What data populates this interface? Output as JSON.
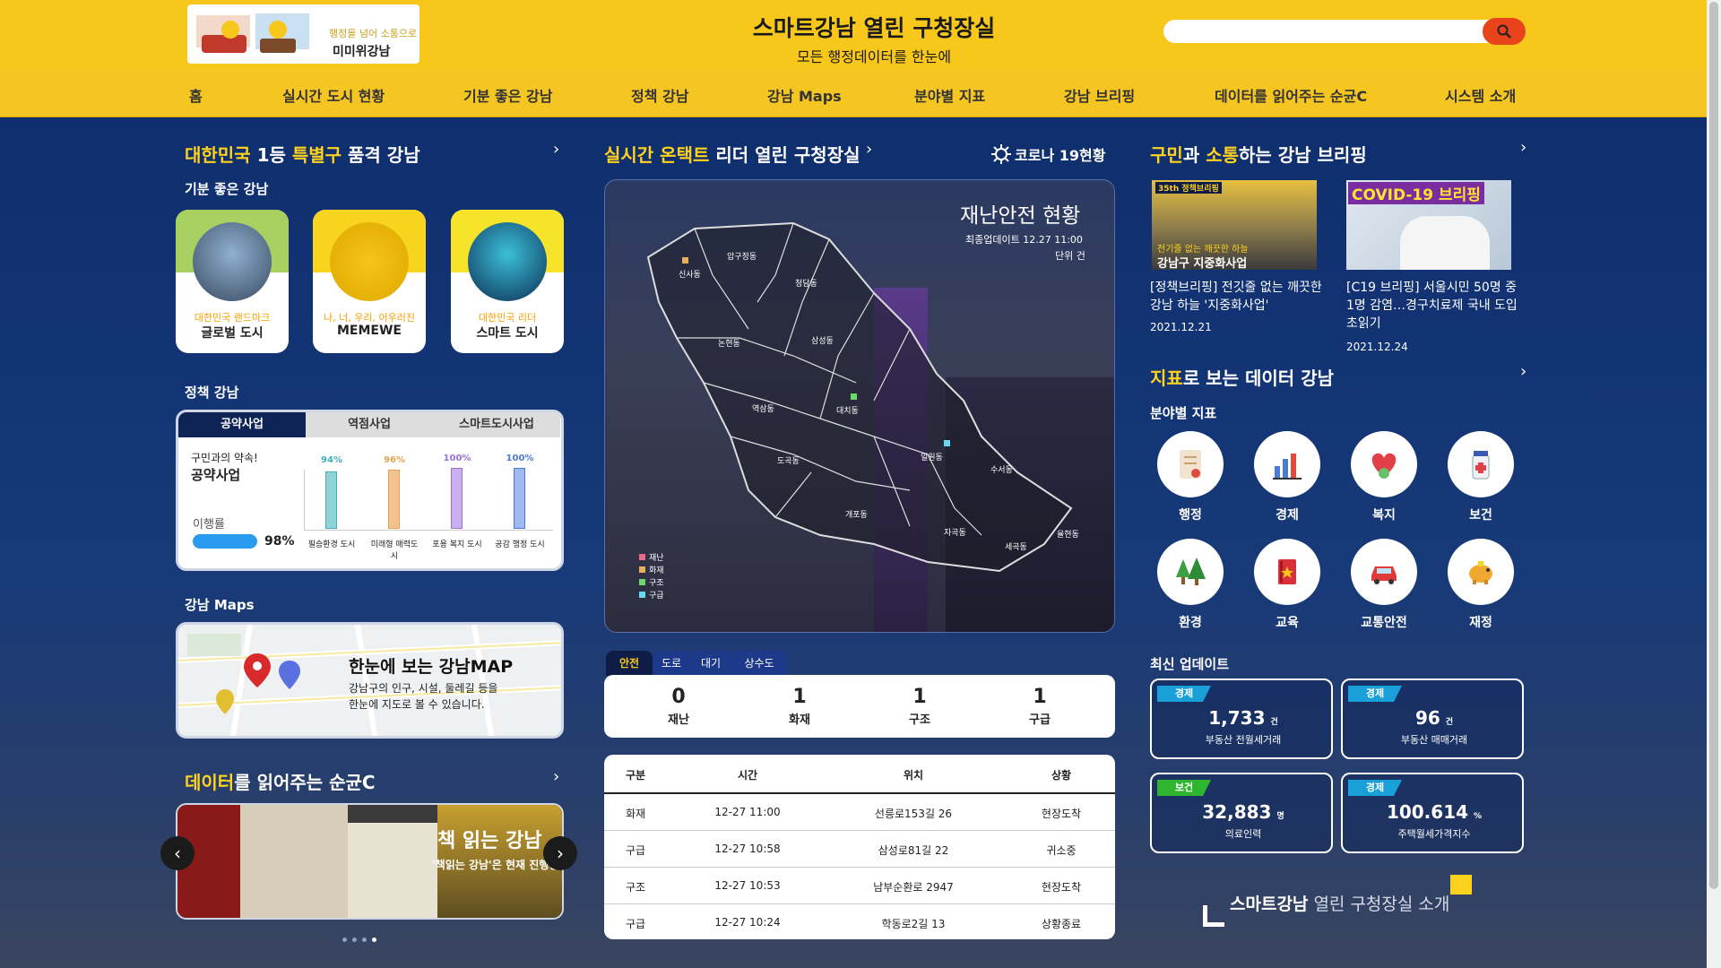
{
  "header": {
    "logo_small": "행정을 넘어 소통으로",
    "logo_text": "미미위강남",
    "title": "스마트강남 열린 구청장실",
    "subtitle": "모든 행정데이터를 한눈에",
    "search_placeholder": ""
  },
  "nav": [
    "홈",
    "실시간 도시 현황",
    "기분 좋은 강남",
    "정책 강남",
    "강남 Maps",
    "분야별 지표",
    "강남 브리핑",
    "데이터를 읽어주는 순균C",
    "시스템 소개"
  ],
  "left": {
    "title_y1": "대한민국",
    "title_w1": " 1등 ",
    "title_y2": "특별구",
    "title_w2": " 품격 강남",
    "mood": "기분 좋은 강남",
    "cards": [
      {
        "sub": "대한민국 랜드마크",
        "main": "글로벌 도시"
      },
      {
        "sub": "나, 너, 우리, 어우러진",
        "main": "MEMEWE"
      },
      {
        "sub": "대한민국 리더",
        "main": "스마트 도시"
      }
    ],
    "policy_title": "정책 강남",
    "policy_tabs": [
      "공약사업",
      "역점사업",
      "스마트도시사업"
    ],
    "policy_promise1": "구민과의 약속!",
    "policy_promise2": "공약사업",
    "policy_rate_label": "이행률",
    "policy_rate": "98%",
    "policy_bars": [
      {
        "pct": "94%",
        "label": "필승환경 도시"
      },
      {
        "pct": "96%",
        "label": "미래형 매력도시"
      },
      {
        "pct": "100%",
        "label": "포용 복지 도시"
      },
      {
        "pct": "100%",
        "label": "공감 행정 도시"
      }
    ],
    "maps_title": "강남 Maps",
    "maps_head": "한눈에 보는 강남MAP",
    "maps_desc1": "강남구의 인구, 시설, 둘레길 등을",
    "maps_desc2": "한눈에 지도로 볼 수 있습니다.",
    "data_title_y": "데이터",
    "data_title_w": "를 읽어주는 순균C",
    "book_head": "책 읽는 강남",
    "book_sub": "'책읽는 강남'은 현재 진행형"
  },
  "center": {
    "title_y": "실시간 온택트",
    "title_w": " 리더 열린 구청장실",
    "covid_btn": "코로나 19현황",
    "safety_title": "재난안전 현황",
    "safety_update": "최종업데이트 12.27 11:00",
    "safety_unit": "단위 건",
    "dongs": [
      "신사동",
      "압구정동",
      "청담동",
      "논현동",
      "삼성동",
      "역삼동",
      "대치동",
      "도곡동",
      "일원동",
      "수서동",
      "개포동",
      "자곡동",
      "세곡동",
      "율현동"
    ],
    "legend": [
      "재난",
      "화재",
      "구조",
      "구급"
    ],
    "tabs": [
      "안전",
      "도로",
      "대기",
      "상수도"
    ],
    "stats": [
      {
        "n": "0",
        "l": "재난"
      },
      {
        "n": "1",
        "l": "화재"
      },
      {
        "n": "1",
        "l": "구조"
      },
      {
        "n": "1",
        "l": "구급"
      }
    ],
    "table_head": [
      "구분",
      "시간",
      "위치",
      "상황"
    ],
    "rows": [
      [
        "화재",
        "12-27 11:00",
        "선릉로153길 26",
        "현장도착"
      ],
      [
        "구급",
        "12-27 10:58",
        "삼성로81길 22",
        "귀소중"
      ],
      [
        "구조",
        "12-27 10:53",
        "남부순환로 2947",
        "현장도착"
      ],
      [
        "구급",
        "12-27 10:24",
        "학동로2길 13",
        "상황종료"
      ]
    ]
  },
  "right": {
    "brief_y1": "구민",
    "brief_w1": "과 ",
    "brief_y2": "소통",
    "brief_w2": "하는 강남 브리핑",
    "briefs": [
      {
        "tag": "35th 정책브리핑",
        "img_text1": "전기줄 없는 깨끗한 하늘",
        "img_text2": "강남구 지중화사업",
        "title": "[정책브리핑] 전깃줄 없는 깨끗한 강남 하늘 '지중화사업'",
        "date": "2021.12.21"
      },
      {
        "tag": "COVID-19 브리핑",
        "title": "[C19 브리핑] 서울시민 50명 중 1명 감염…경구치료제 국내 도입 초읽기",
        "date": "2021.12.24"
      }
    ],
    "ind_title_y": "지표",
    "ind_title_w": "로 보는 데이터 강남",
    "ind_sub": "분야별 지표",
    "indicators": [
      "행정",
      "경제",
      "복지",
      "보건",
      "환경",
      "교육",
      "교통안전",
      "재정"
    ],
    "upd_title": "최신 업데이트",
    "updates": [
      {
        "badge": "경제",
        "val": "1,733",
        "unit": "건",
        "cap": "부동산 전월세거래",
        "color": "#1aa0d8"
      },
      {
        "badge": "경제",
        "val": "96",
        "unit": "건",
        "cap": "부동산 매매거래",
        "color": "#1aa0d8"
      },
      {
        "badge": "보건",
        "val": "32,883",
        "unit": "명",
        "cap": "의료인력",
        "color": "#2fb52f"
      },
      {
        "badge": "경제",
        "val": "100.614",
        "unit": "%",
        "cap": "주택월세가격지수",
        "color": "#1aa0d8"
      }
    ],
    "intro_y": "스마트강남",
    "intro_w": " 열린 구청장실 소개"
  }
}
